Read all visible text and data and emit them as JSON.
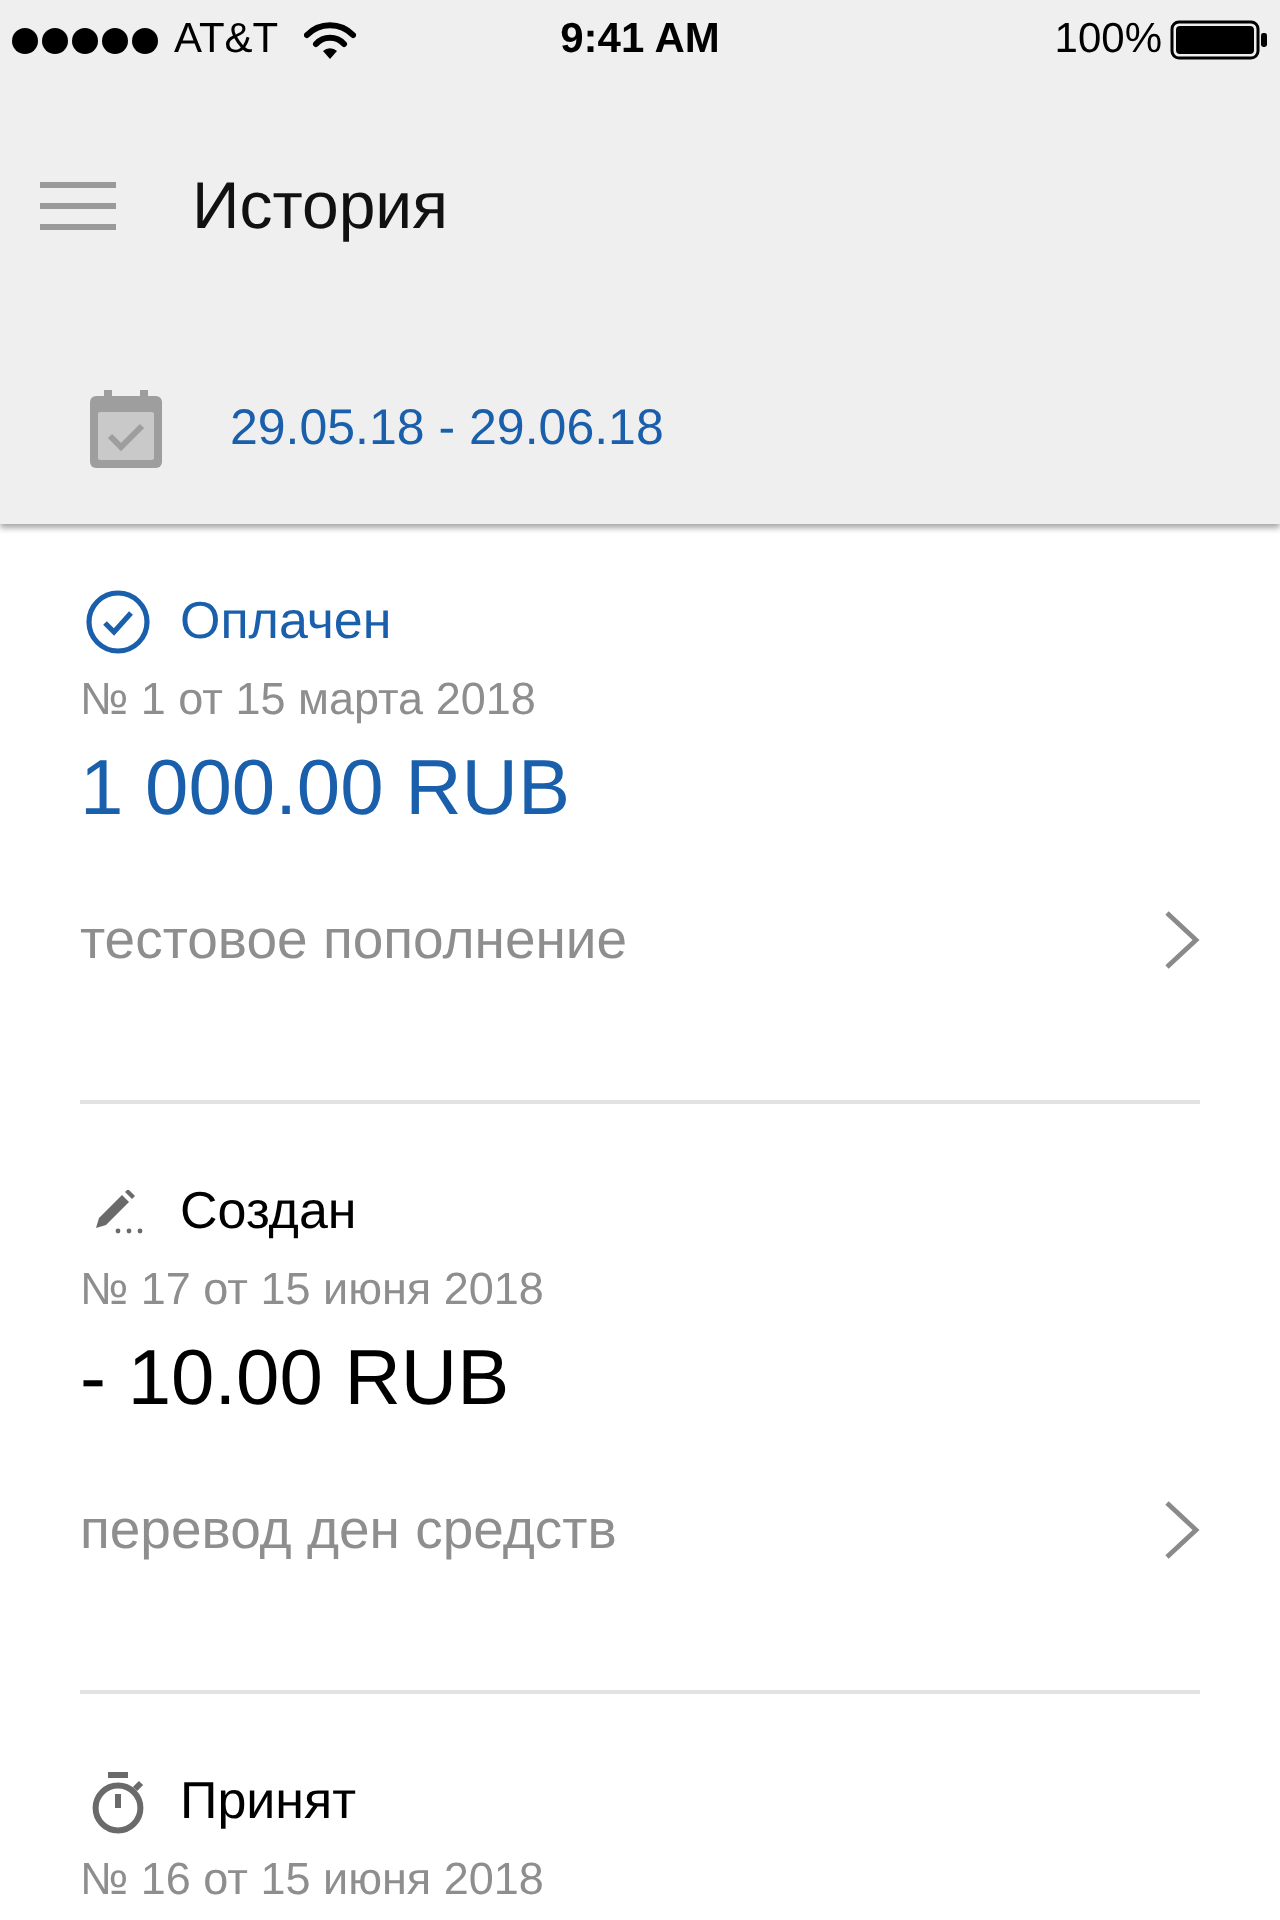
{
  "status_bar": {
    "carrier": "AT&T",
    "time": "9:41 AM",
    "battery": "100%"
  },
  "header": {
    "title": "История",
    "date_range": "29.05.18 - 29.06.18"
  },
  "transactions": [
    {
      "kind": "paid",
      "status": "Оплачен",
      "number": "№ 1 от 15 марта 2018",
      "amount": "1 000.00 RUB",
      "description": "тестовое пополнение"
    },
    {
      "kind": "created",
      "status": "Создан",
      "number": "№ 17 от 15 июня 2018",
      "amount": "- 10.00 RUB",
      "description": "перевод ден средств"
    },
    {
      "kind": "accepted",
      "status": "Принят",
      "number": "№ 16 от 15 июня 2018"
    }
  ]
}
